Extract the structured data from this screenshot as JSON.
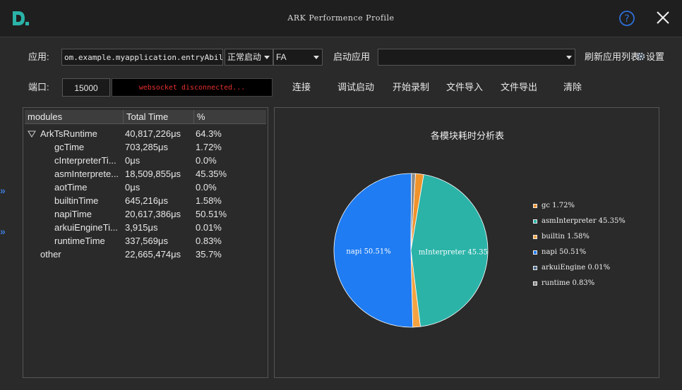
{
  "window": {
    "title": "ARK Performence Profile"
  },
  "toolbar": {
    "app_label": "应用:",
    "app_value": "om.example.myapplication.entryAbility",
    "launch_mode": "正常启动",
    "ability_type": "FA",
    "launch_app_button": "启动应用",
    "app_list_value": "",
    "refresh_button": "刷新应用列表",
    "settings_button": "设置",
    "port_label": "端口:",
    "port_value": "15000",
    "ws_status": "websocket disconnected...",
    "connect_button": "连接",
    "debug_launch_button": "调试启动",
    "record_button": "开始录制",
    "import_button": "文件导入",
    "export_button": "文件导出",
    "clear_button": "清除"
  },
  "tree": {
    "headers": [
      "modules",
      "Total Time",
      "%"
    ],
    "rows": [
      {
        "name": "ArkTsRuntime",
        "time": "40,817,226μs",
        "pct": "64.3%",
        "level": 0,
        "expandable": true
      },
      {
        "name": "gcTime",
        "time": "703,285μs",
        "pct": "1.72%",
        "level": 1
      },
      {
        "name": "cInterpreterTi...",
        "time": "0μs",
        "pct": "0.0%",
        "level": 1
      },
      {
        "name": "asmInterprete...",
        "time": "18,509,855μs",
        "pct": "45.35%",
        "level": 1
      },
      {
        "name": "aotTime",
        "time": "0μs",
        "pct": "0.0%",
        "level": 1
      },
      {
        "name": "builtinTime",
        "time": "645,216μs",
        "pct": "1.58%",
        "level": 1
      },
      {
        "name": "napiTime",
        "time": "20,617,386μs",
        "pct": "50.51%",
        "level": 1
      },
      {
        "name": "arkuiEngineTi...",
        "time": "3,915μs",
        "pct": "0.01%",
        "level": 1
      },
      {
        "name": "runtimeTime",
        "time": "337,569μs",
        "pct": "0.83%",
        "level": 1
      },
      {
        "name": "other",
        "time": "22,665,474μs",
        "pct": "35.7%",
        "level": 0
      }
    ]
  },
  "side_icons": [
    "»",
    "»"
  ],
  "colors": {
    "gc": "#f0932b",
    "asm": "#2bb3a8",
    "builtin": "#f4a340",
    "napi": "#1f7cf2",
    "arkui": "#4a6a8a",
    "runtime": "#8a8a8a",
    "ws_text": "#e83030",
    "accent": "#3d7bd8"
  },
  "chart_data": {
    "type": "pie",
    "title": "各模块耗时分析表",
    "slices": [
      {
        "key": "gc",
        "name": "gc",
        "value": 1.72,
        "legend": "gc 1.72%"
      },
      {
        "key": "asm",
        "name": "asmInterpreter",
        "value": 45.35,
        "legend": "asmInterpreter 45.35%",
        "label": "mInterpreter 45.35"
      },
      {
        "key": "builtin",
        "name": "builtin",
        "value": 1.58,
        "legend": "builtin 1.58%"
      },
      {
        "key": "napi",
        "name": "napi",
        "value": 50.51,
        "legend": "napi 50.51%",
        "label": "napi 50.51%"
      },
      {
        "key": "arkui",
        "name": "arkuiEngine",
        "value": 0.01,
        "legend": "arkuiEngine 0.01%"
      },
      {
        "key": "runtime",
        "name": "runtime",
        "value": 0.83,
        "legend": "runtime 0.83%"
      }
    ],
    "legend_position": "right"
  }
}
